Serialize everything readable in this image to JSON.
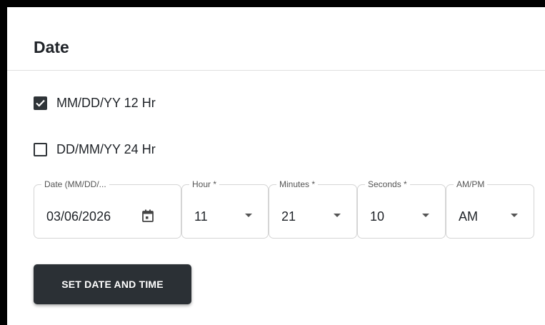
{
  "section": {
    "title": "Date"
  },
  "formats": [
    {
      "label": "MM/DD/YY 12 Hr",
      "checked": true
    },
    {
      "label": "DD/MM/YY 24 Hr",
      "checked": false
    }
  ],
  "fields": {
    "date": {
      "label": "Date (MM/DD/...",
      "value": "03/06/2026",
      "icon": "calendar-icon"
    },
    "hour": {
      "label": "Hour *",
      "value": "11"
    },
    "minutes": {
      "label": "Minutes *",
      "value": "21"
    },
    "seconds": {
      "label": "Seconds *",
      "value": "10"
    },
    "ampm": {
      "label": "AM/PM",
      "value": "AM"
    }
  },
  "actions": {
    "set_label": "SET DATE AND TIME"
  },
  "colors": {
    "button_bg": "#2b3035",
    "checkbox": "#2f3438"
  }
}
